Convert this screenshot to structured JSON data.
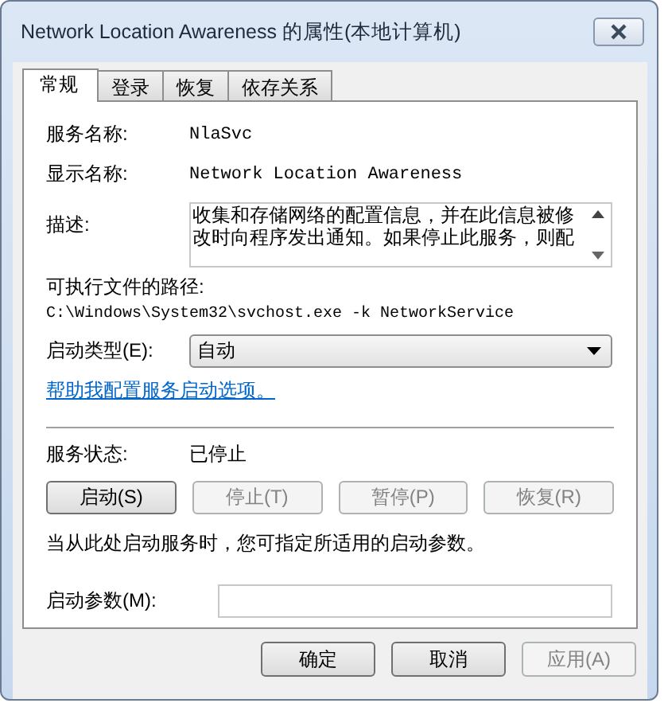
{
  "window": {
    "title": "Network Location Awareness 的属性(本地计算机)"
  },
  "tabs": [
    {
      "label": "常规",
      "selected": true
    },
    {
      "label": "登录",
      "selected": false
    },
    {
      "label": "恢复",
      "selected": false
    },
    {
      "label": "依存关系",
      "selected": false
    }
  ],
  "fields": {
    "service_name_label": "服务名称:",
    "service_name": "NlaSvc",
    "display_name_label": "显示名称:",
    "display_name": "Network Location Awareness",
    "description_label": "描述:",
    "description": "收集和存储网络的配置信息，并在此信息被修改时向程序发出通知。如果停止此服务，则配",
    "path_label": "可执行文件的路径:",
    "path": "C:\\Windows\\System32\\svchost.exe -k NetworkService",
    "startup_type_label": "启动类型(E):",
    "startup_type": "自动",
    "help_link": "帮助我配置服务启动选项。"
  },
  "status": {
    "label": "服务状态:",
    "value": "已停止"
  },
  "service_buttons": [
    {
      "label": "启动(S)",
      "disabled": false
    },
    {
      "label": "停止(T)",
      "disabled": true
    },
    {
      "label": "暂停(P)",
      "disabled": true
    },
    {
      "label": "恢复(R)",
      "disabled": true
    }
  ],
  "hint": "当从此处启动服务时，您可指定所适用的启动参数。",
  "params": {
    "label": "启动参数(M):"
  },
  "dialog_buttons": [
    {
      "label": "确定",
      "disabled": false
    },
    {
      "label": "取消",
      "disabled": false
    },
    {
      "label": "应用(A)",
      "disabled": true
    }
  ]
}
